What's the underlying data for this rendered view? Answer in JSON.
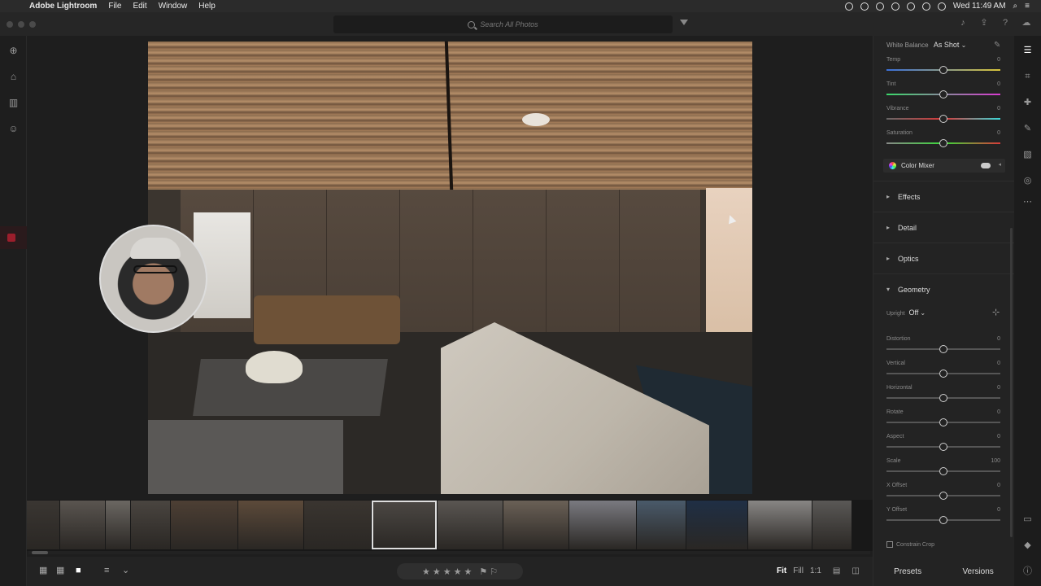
{
  "menubar": {
    "app_name": "Adobe Lightroom",
    "items": [
      "File",
      "Edit",
      "Window",
      "Help"
    ],
    "clock": "Wed 11:49 AM"
  },
  "search": {
    "placeholder": "Search All Photos"
  },
  "panel": {
    "white_balance_label": "White Balance",
    "white_balance_value": "As Shot",
    "color_sliders": [
      {
        "label": "Temp",
        "value": "0",
        "pos": 0.5
      },
      {
        "label": "Tint",
        "value": "0",
        "pos": 0.5
      },
      {
        "label": "Vibrance",
        "value": "0",
        "pos": 0.5
      },
      {
        "label": "Saturation",
        "value": "0",
        "pos": 0.5
      }
    ],
    "color_mixer": "Color Mixer",
    "sections": [
      "Effects",
      "Detail",
      "Optics"
    ],
    "geometry": "Geometry",
    "upright_label": "Upright",
    "upright_value": "Off",
    "geometry_sliders": [
      {
        "label": "Distortion",
        "value": "0",
        "pos": 0.5
      },
      {
        "label": "Vertical",
        "value": "0",
        "pos": 0.5
      },
      {
        "label": "Horizontal",
        "value": "0",
        "pos": 0.5
      },
      {
        "label": "Rotate",
        "value": "0",
        "pos": 0.5
      },
      {
        "label": "Aspect",
        "value": "0",
        "pos": 0.5
      },
      {
        "label": "Scale",
        "value": "100",
        "pos": 0.5
      },
      {
        "label": "X Offset",
        "value": "0",
        "pos": 0.5
      },
      {
        "label": "Y Offset",
        "value": "0",
        "pos": 0.5
      }
    ],
    "constrain_crop": "Constrain Crop"
  },
  "bottom": {
    "view_fit": "Fit",
    "view_fill": "Fill",
    "view_1to1": "1:1",
    "presets": "Presets",
    "versions": "Versions"
  },
  "filmstrip_colors": [
    "#3a3632",
    "#5a5550",
    "#6b6762",
    "#4a4540",
    "#4d3f34",
    "#5c4a3a",
    "#3a3530",
    "#4c4844",
    "#5a5652",
    "#6a6056",
    "#7a7a80",
    "#4a5a6a",
    "#1f2f45",
    "#888684",
    "#5a5856"
  ],
  "colors": {
    "accent": "#dedede",
    "panel": "#232323",
    "selected_outline": "#dedede"
  }
}
